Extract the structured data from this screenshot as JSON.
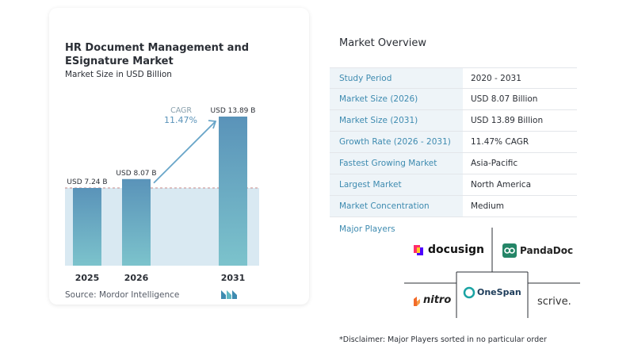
{
  "chart_data": {
    "type": "bar",
    "title": "HR Document Management and ESignature Market",
    "subtitle": "Market Size in USD Billion",
    "categories": [
      "2025",
      "2026",
      "2031"
    ],
    "values": [
      7.24,
      8.07,
      13.89
    ],
    "data_labels": [
      "USD 7.24 B",
      "USD 8.07 B",
      "USD 13.89 B"
    ],
    "cagr_label": "CAGR",
    "cagr_value": "11.47%",
    "ylim": [
      0,
      15
    ],
    "bar_color_top": "#5a93b9",
    "bar_color_bottom": "#7cc3cc",
    "band_color": "#d9e9f2",
    "arrow_color": "#6aa6c9"
  },
  "source_text": "Source:  Mordor Intelligence",
  "overview": {
    "title": "Market Overview",
    "rows": [
      {
        "label": "Study Period",
        "value": "2020 - 2031"
      },
      {
        "label": "Market Size (2026)",
        "value": "USD 8.07 Billion"
      },
      {
        "label": "Market Size (2031)",
        "value": "USD 13.89 Billion"
      },
      {
        "label": "Growth Rate (2026 - 2031)",
        "value": "11.47% CAGR"
      },
      {
        "label": "Fastest Growing Market",
        "value": "Asia-Pacific"
      },
      {
        "label": "Largest Market",
        "value": "North America"
      },
      {
        "label": "Market Concentration",
        "value": "Medium"
      }
    ]
  },
  "players": {
    "title": "Major Players",
    "names": [
      "docusign",
      "PandaDoc",
      "nitro",
      "OneSpan",
      "scrive."
    ]
  },
  "disclaimer": "*Disclaimer: Major Players sorted in no particular order",
  "colors": {
    "accent": "#3e8bb0",
    "label_bg": "#eef4f8"
  }
}
